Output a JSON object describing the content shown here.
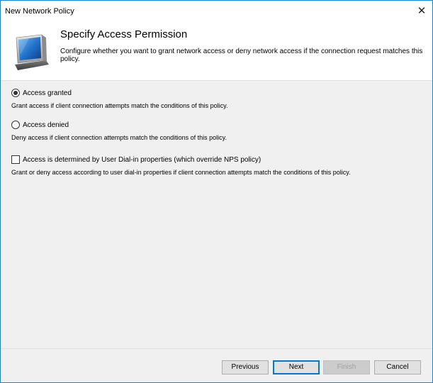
{
  "window": {
    "title": "New Network Policy",
    "close_glyph": "✕"
  },
  "header": {
    "title": "Specify Access Permission",
    "description": "Configure whether you want to grant network access or deny network access if the connection request matches this policy.",
    "icon": "monitor-icon"
  },
  "options": [
    {
      "type": "radio",
      "checked": true,
      "label": "Access granted",
      "description": "Grant access if client connection attempts match the conditions of this policy."
    },
    {
      "type": "radio",
      "checked": false,
      "label": "Access denied",
      "description": "Deny access if client connection attempts match the conditions of this policy."
    },
    {
      "type": "checkbox",
      "checked": false,
      "label": "Access is determined by User Dial-in properties (which override NPS policy)",
      "description": "Grant or deny access according to user dial-in properties if client connection attempts match the conditions of this policy."
    }
  ],
  "buttons": {
    "previous": "Previous",
    "next": "Next",
    "finish": "Finish",
    "cancel": "Cancel"
  },
  "colors": {
    "window_border": "#1883d7",
    "panel_background": "#f0f0f0",
    "default_button_border": "#0078d7"
  }
}
